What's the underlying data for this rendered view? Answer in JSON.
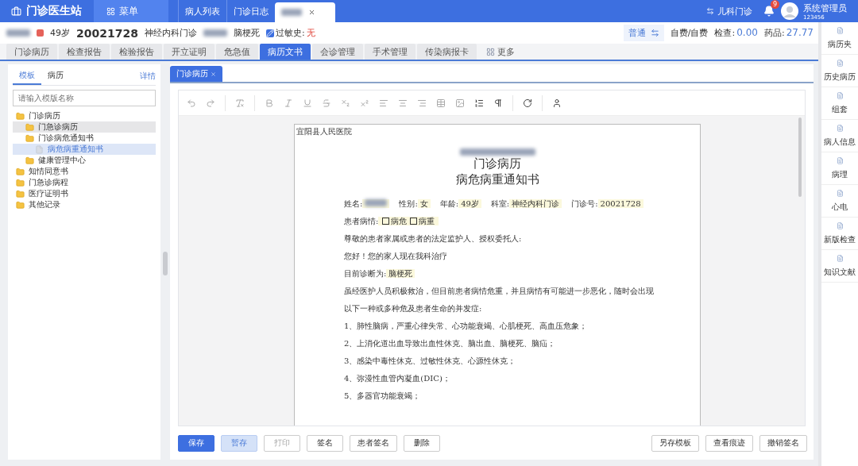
{
  "app": {
    "title": "门诊医生站",
    "menu": "菜单",
    "nav": [
      {
        "label": "病人列表",
        "selected": false
      },
      {
        "label": "门诊日志",
        "selected": false
      },
      {
        "selected": true
      }
    ],
    "switch": "儿科门诊",
    "notifications": "9",
    "user": {
      "name": "系统管理员",
      "id": "123456"
    }
  },
  "patient": {
    "age": "49岁",
    "number": "20021728",
    "department": "神经内科门诊",
    "diagnosis": "脑梗死",
    "allergy_label": "过敏史:",
    "allergy": "无",
    "level": "普通",
    "payment": "自费/自费",
    "exam_label": "检查:",
    "exam": "0.00",
    "drug_label": "药品:",
    "drug": "27.77"
  },
  "tabs": [
    {
      "label": "门诊病历",
      "selected": false
    },
    {
      "label": "检查报告",
      "selected": false
    },
    {
      "label": "检验报告",
      "selected": false
    },
    {
      "label": "开立证明",
      "selected": false
    },
    {
      "label": "危急值",
      "selected": false
    },
    {
      "label": "病历文书",
      "selected": true
    },
    {
      "label": "会诊管理",
      "selected": false
    },
    {
      "label": "手术管理",
      "selected": false
    },
    {
      "label": "传染病报卡",
      "selected": false
    },
    {
      "label": "更多",
      "selected": false
    }
  ],
  "left_panel": {
    "tabs": [
      {
        "label": "模板",
        "selected": true
      },
      {
        "label": "病历",
        "selected": false
      }
    ],
    "detail": "详情",
    "search": {
      "placeholder": "请输入模版名称"
    },
    "tree": [
      {
        "label": "门诊病历",
        "kind": "folder",
        "selected": false,
        "hovered": false,
        "children": [
          {
            "label": "门急诊病历",
            "kind": "folder",
            "selected": false,
            "hovered": true
          },
          {
            "label": "门诊病危通知书",
            "kind": "folder",
            "selected": false,
            "hovered": false,
            "children": [
              {
                "label": "病危病重通知书",
                "kind": "file",
                "selected": true,
                "hovered": false
              }
            ]
          },
          {
            "label": "健康管理中心",
            "kind": "folder",
            "selected": false,
            "hovered": false
          }
        ]
      },
      {
        "label": "知情同意书",
        "kind": "folder",
        "selected": false,
        "hovered": false
      },
      {
        "label": "门急诊病程",
        "kind": "folder",
        "selected": false,
        "hovered": false
      },
      {
        "label": "医疗证明书",
        "kind": "folder",
        "selected": false,
        "hovered": false
      },
      {
        "label": "其他记录",
        "kind": "folder",
        "selected": false,
        "hovered": false
      }
    ]
  },
  "editor": {
    "tab": "门诊病历",
    "document": {
      "header": "宜阳县人民医院",
      "title": "门诊病历",
      "subtitle": "病危病重通知书",
      "fields": [
        {
          "label": "姓名:"
        },
        {
          "label": "性别:",
          "value": "女"
        },
        {
          "label": "年龄:",
          "value": "49岁"
        },
        {
          "label": "科室:",
          "value": "神经内科门诊"
        },
        {
          "label": "门诊号:",
          "value": "20021728"
        }
      ],
      "condition_label": "患者病情:",
      "conditions": [
        {
          "label": "病危",
          "checked": false
        },
        {
          "label": "病重",
          "checked": false
        }
      ],
      "lines": [
        {
          "text": "尊敬的患者家属或患者的法定监护人、授权委托人:"
        },
        {
          "text": "您好！您的家人现在我科治疗"
        },
        {
          "text": "目前诊断为:",
          "value": "脑梗死"
        },
        {
          "text": "虽经医护人员积极救治，但目前患者病情危重，并且病情有可能进一步恶化，随时会出现以下一种或多种危及患者生命的并发症:"
        },
        {
          "text": "1、肺性脑病，严重心律失常、心功能衰竭、心肌梗死、高血压危象；"
        },
        {
          "text": "2、上消化道出血导致出血性休克、脑出血、脑梗死、脑疝；"
        },
        {
          "text": "3、感染中毒性休克、过敏性休克、心源性休克；"
        },
        {
          "text": "4、弥漫性血管内凝血(DIC)；"
        },
        {
          "text": "5、多器官功能衰竭；"
        }
      ]
    }
  },
  "buttons_left": [
    {
      "label": "保存",
      "kind": "primary"
    },
    {
      "label": "暂存",
      "kind": "secondary"
    },
    {
      "label": "打印",
      "kind": "disabled"
    },
    {
      "label": "签名",
      "kind": "default"
    },
    {
      "label": "患者签名",
      "kind": "default"
    },
    {
      "label": "删除",
      "kind": "default"
    }
  ],
  "buttons_right": [
    {
      "label": "另存模板",
      "kind": "default"
    },
    {
      "label": "查看痕迹",
      "kind": "default"
    },
    {
      "label": "撤销签名",
      "kind": "default"
    }
  ],
  "sidebar": [
    {
      "label": "病历夹"
    },
    {
      "label": "历史病历"
    },
    {
      "label": "组套"
    },
    {
      "label": "病人信息"
    },
    {
      "label": "病理"
    },
    {
      "label": "心电"
    },
    {
      "label": "新版检查"
    },
    {
      "label": "知识文献"
    }
  ]
}
